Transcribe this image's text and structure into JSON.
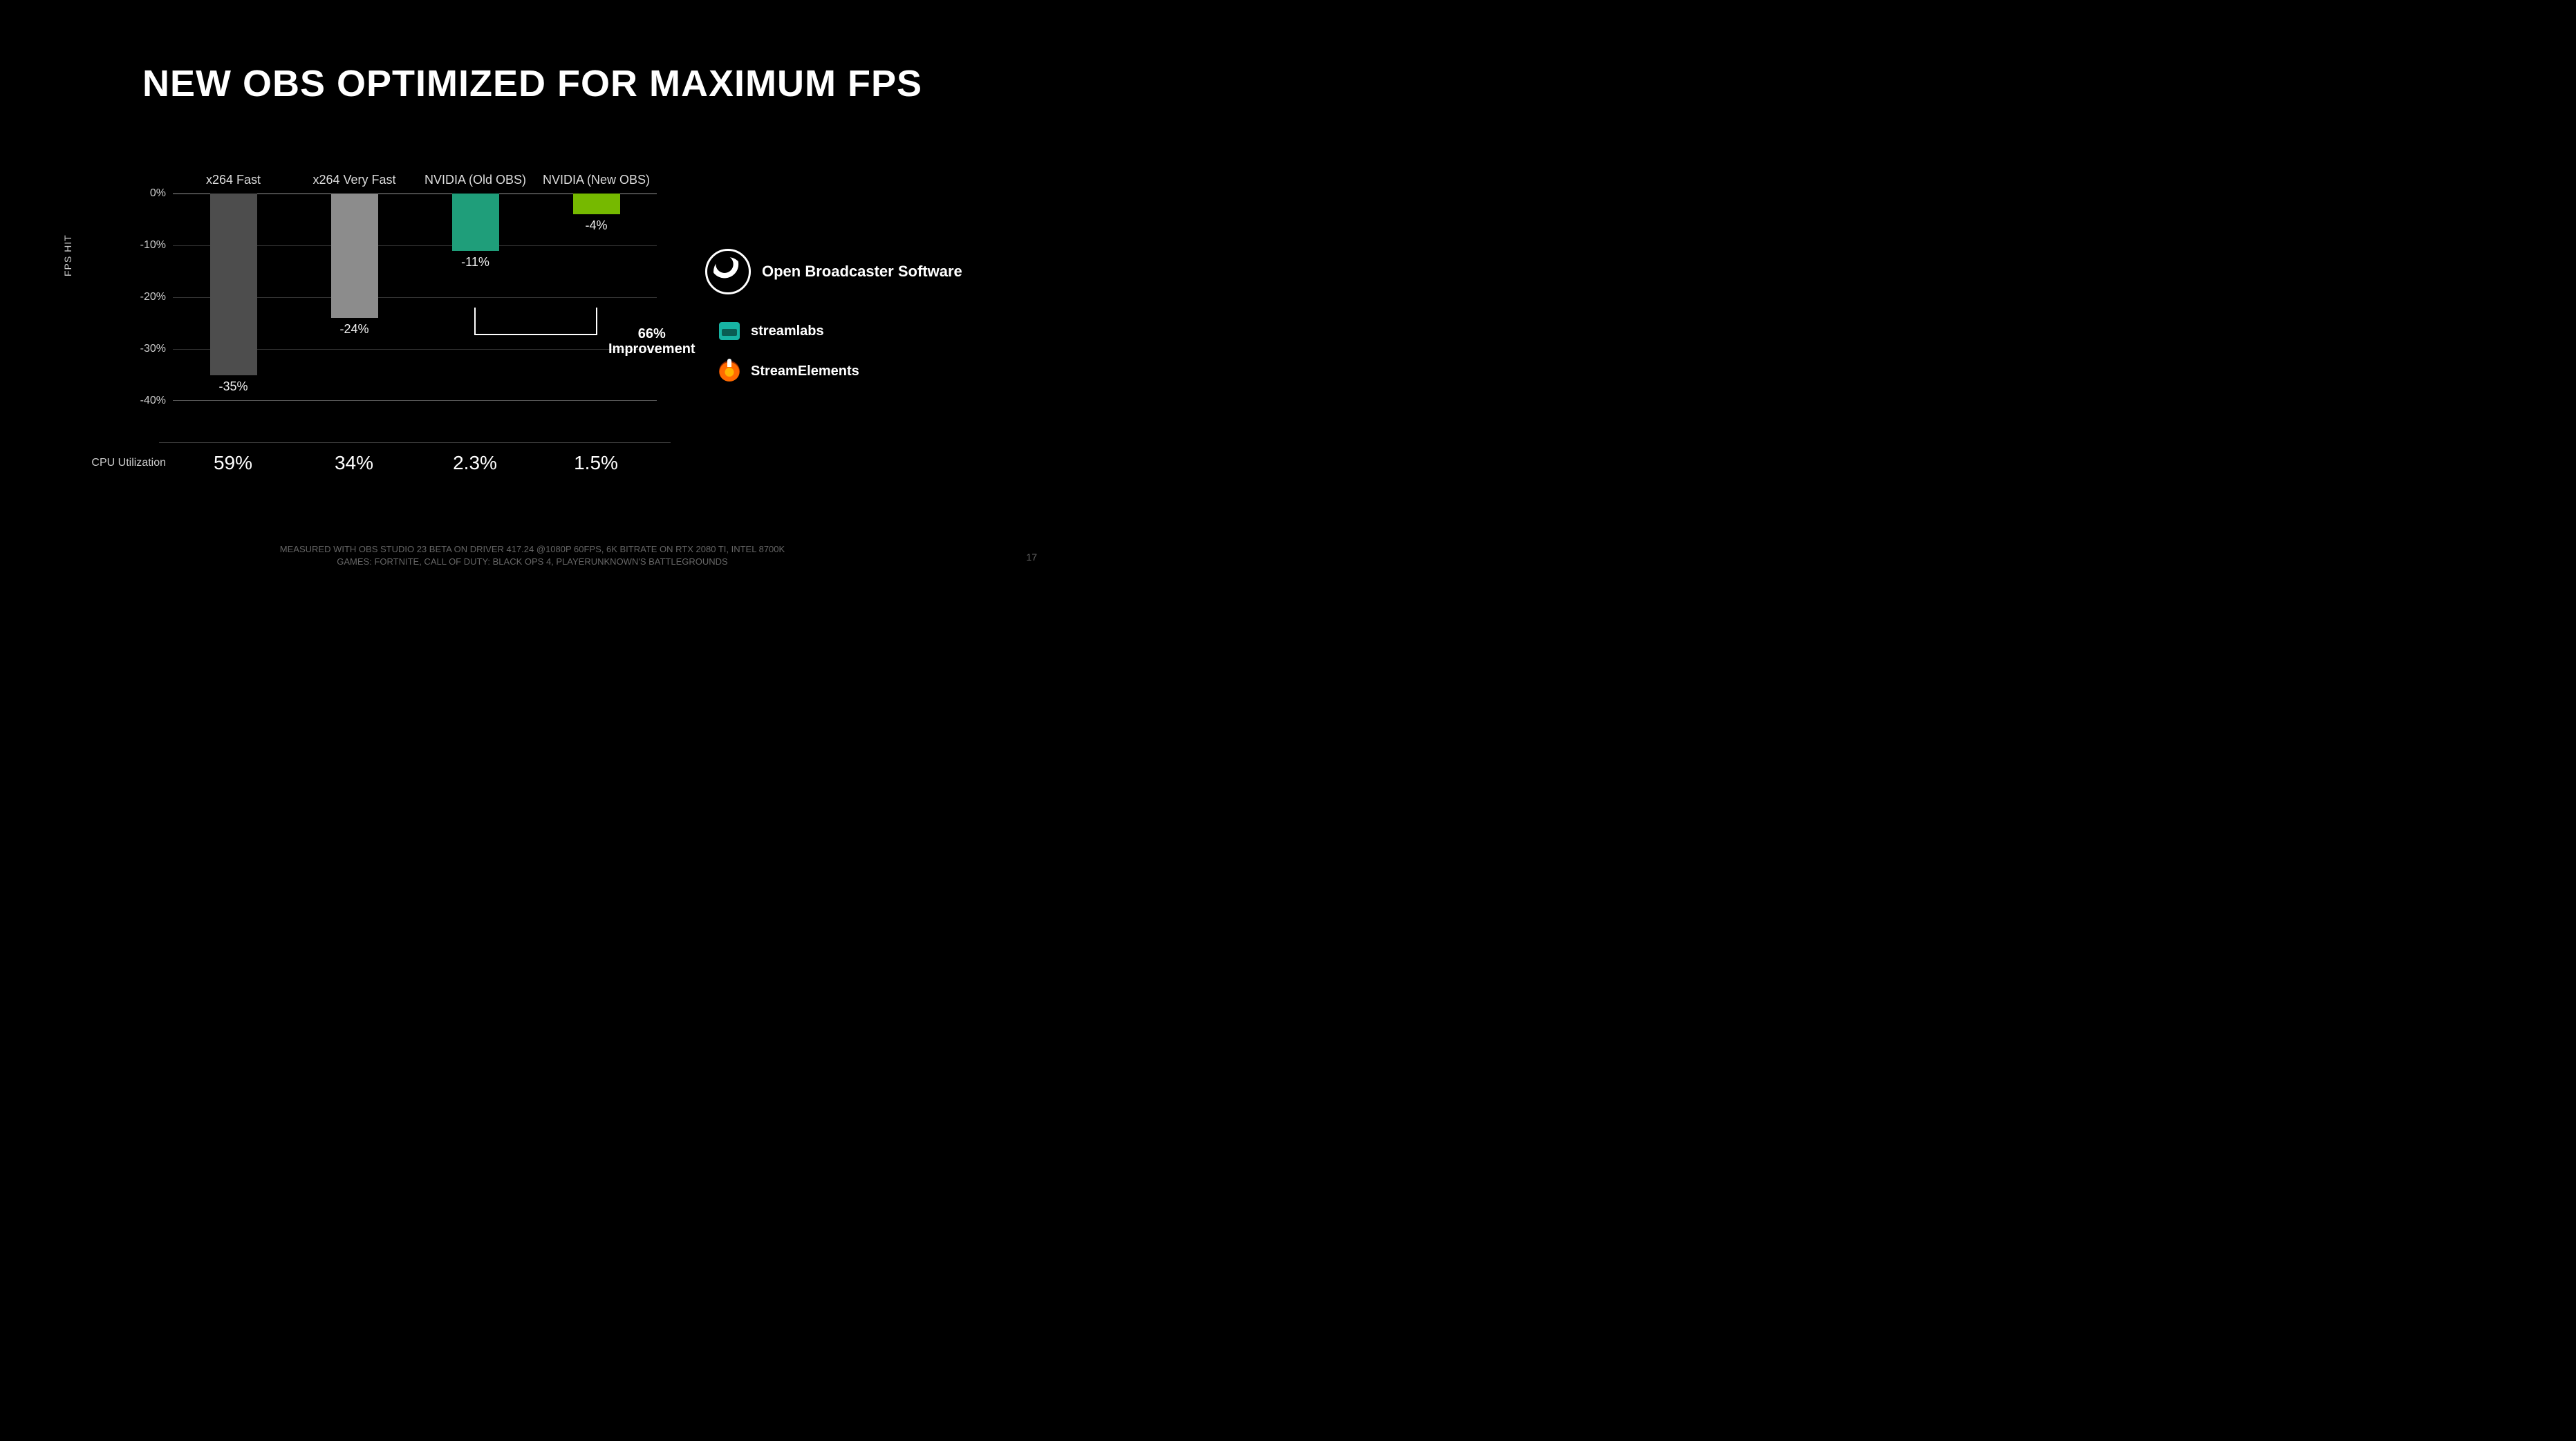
{
  "title": "NEW OBS OPTIMIZED FOR MAXIMUM FPS",
  "chart_data": {
    "type": "bar",
    "ylabel": "FPS HIT",
    "ylim": [
      -40,
      0
    ],
    "yticks": [
      "0%",
      "-10%",
      "-20%",
      "-30%",
      "-40%"
    ],
    "categories": [
      "x264 Fast",
      "x264 Very Fast",
      "NVIDIA (Old OBS)",
      "NVIDIA (New OBS)"
    ],
    "values": [
      -35,
      -24,
      -11,
      -4
    ],
    "value_labels": [
      "-35%",
      "-24%",
      "-11%",
      "-4%"
    ],
    "colors": [
      "#4d4d4d",
      "#8c8c8c",
      "#1f9e7a",
      "#76b900"
    ],
    "annotation": {
      "text_line1": "66%",
      "text_line2": "Improvement",
      "from_index": 2,
      "to_index": 3
    }
  },
  "cpu": {
    "label": "CPU Utilization",
    "values": [
      "59%",
      "34%",
      "2.3%",
      "1.5%"
    ]
  },
  "logos": {
    "obs": "Open Broadcaster Software",
    "streamlabs": "streamlabs",
    "streamelements": "StreamElements"
  },
  "footnote_line1": "MEASURED WITH OBS STUDIO 23 BETA ON DRIVER 417.24 @1080P 60FPS, 6K BITRATE ON RTX 2080 TI, INTEL 8700K",
  "footnote_line2": "GAMES: FORTNITE, CALL OF DUTY: BLACK OPS 4, PLAYERUNKNOWN'S BATTLEGROUNDS",
  "page": "17"
}
